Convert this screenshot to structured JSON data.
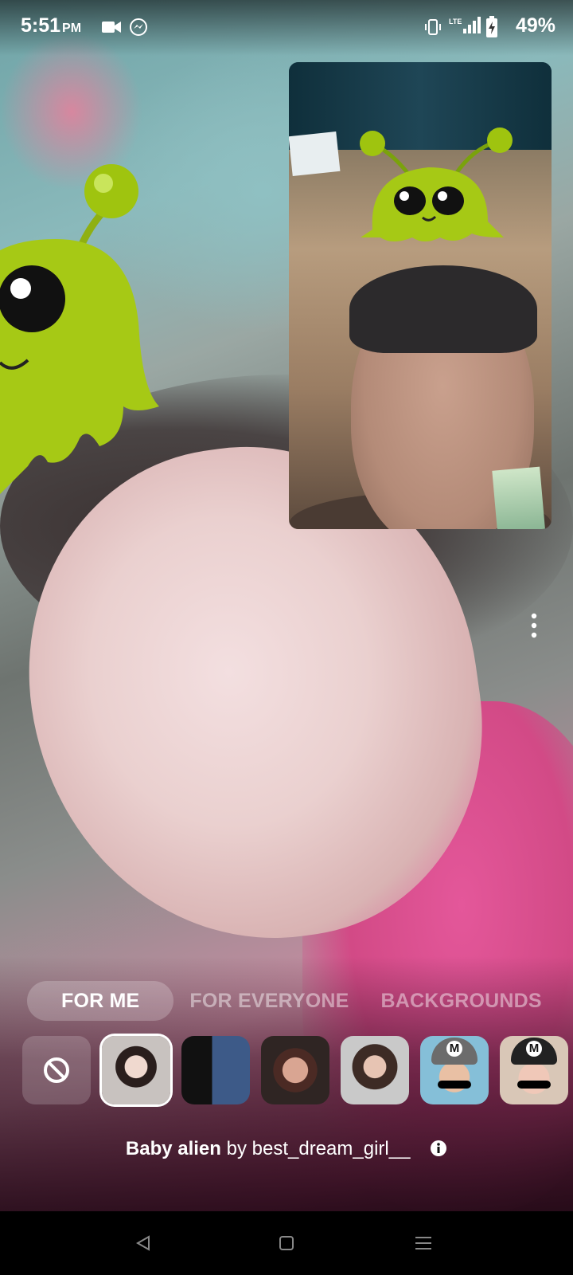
{
  "status_bar": {
    "time": "5:51",
    "ampm": "PM",
    "battery": "49%",
    "icons": [
      "video-camera-icon",
      "messenger-icon",
      "vibrate-icon",
      "lte-signal-icon",
      "battery-charging-icon"
    ]
  },
  "effects": {
    "tabs": [
      {
        "label": "FOR ME",
        "active": true
      },
      {
        "label": "FOR EVERYONE",
        "active": false
      },
      {
        "label": "BACKGROUNDS",
        "active": false
      }
    ],
    "thumbnails": [
      {
        "name": "no-effect",
        "selected": false
      },
      {
        "name": "effect-1",
        "selected": true
      },
      {
        "name": "effect-2",
        "selected": false
      },
      {
        "name": "effect-3",
        "selected": false
      },
      {
        "name": "effect-4",
        "selected": false
      },
      {
        "name": "effect-5",
        "selected": false
      },
      {
        "name": "effect-6",
        "selected": false
      }
    ],
    "cap_letter": "M"
  },
  "credit": {
    "effect_name": "Baby alien",
    "by": "by",
    "author": "best_dream_girl__"
  },
  "colors": {
    "alien_green": "#9fc40f",
    "active_tab_bg": "rgba(255,255,255,0.22)"
  }
}
